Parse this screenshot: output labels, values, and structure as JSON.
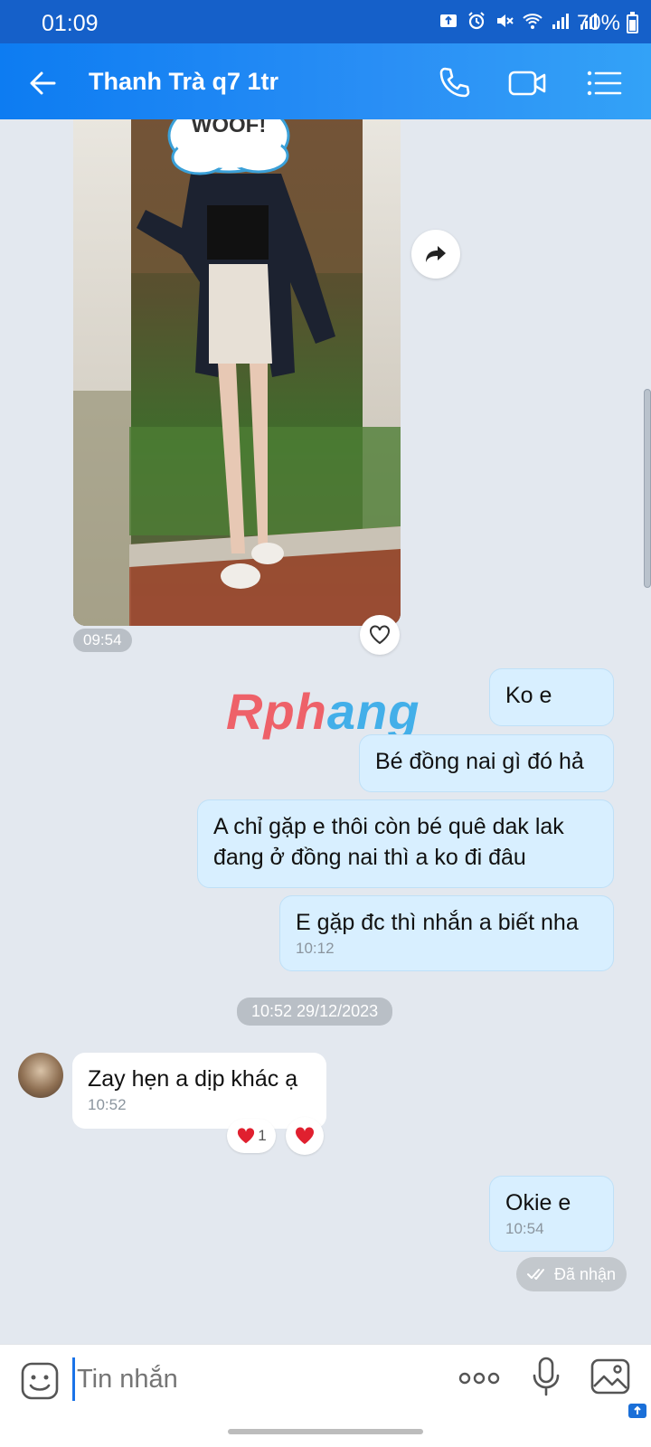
{
  "status_bar": {
    "time": "01:09",
    "battery_percent": "70%",
    "icons": [
      "upload-icon",
      "alarm-icon",
      "mute-icon",
      "wifi-icon",
      "signal-icon",
      "signal-icon",
      "battery-icon"
    ]
  },
  "header": {
    "contact_name": "Thanh Trà q7 1tr",
    "actions": [
      "phone-icon",
      "video-call-icon",
      "menu-list-icon"
    ]
  },
  "messages": {
    "photo_time": "09:54",
    "out_1": "Ko e",
    "out_2": "Bé đồng nai gì đó hả",
    "out_3_line1": "A chỉ gặp e thôi còn bé quê dak lak",
    "out_3_line2": "đang ở đồng nai thì a ko đi đâu",
    "out_4": "E gặp đc thì nhắn a biết nha",
    "out_4_time": "10:12",
    "date_separator": "10:52 29/12/2023",
    "in_1": "Zay hẹn a dịp khác ạ",
    "in_1_time": "10:52",
    "in_1_reaction_count": "1",
    "out_5": "Okie e",
    "out_5_time": "10:54",
    "status": "Đã nhận"
  },
  "photo_sticker_text": "WOOF!",
  "watermark": {
    "part1": "Rph",
    "part2": "ang"
  },
  "composer": {
    "placeholder": "Tin nhắn"
  },
  "colors": {
    "header": "#1a84f3",
    "outgoing_bubble": "#d8efff",
    "incoming_bubble": "#ffffff",
    "chat_background": "#e3e8ef"
  }
}
